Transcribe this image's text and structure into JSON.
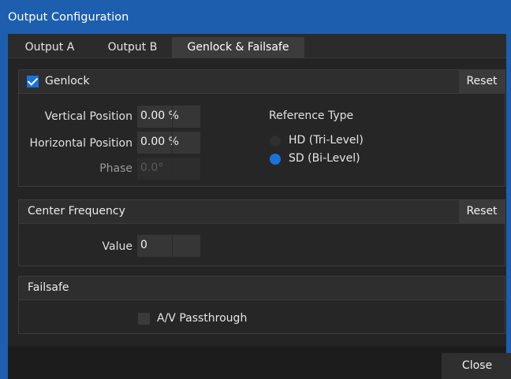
{
  "window": {
    "title": "Output Configuration"
  },
  "tabs": [
    {
      "label": "Output A"
    },
    {
      "label": "Output B"
    },
    {
      "label": "Genlock & Failsafe"
    }
  ],
  "genlock": {
    "label": "Genlock",
    "enabled": true,
    "reset_label": "Reset",
    "vertical_position": {
      "label": "Vertical Position",
      "value": "0.00 %"
    },
    "horizontal_position": {
      "label": "Horizontal Position",
      "value": "0.00 %"
    },
    "phase": {
      "label": "Phase",
      "value": "0.0°"
    },
    "reference_type": {
      "label": "Reference Type",
      "options": [
        {
          "label": "HD (Tri-Level)",
          "selected": false
        },
        {
          "label": "SD (Bi-Level)",
          "selected": true
        }
      ]
    }
  },
  "center_frequency": {
    "label": "Center Frequency",
    "reset_label": "Reset",
    "value_field": {
      "label": "Value",
      "value": "0"
    }
  },
  "failsafe": {
    "label": "Failsafe",
    "av_passthrough": {
      "label": "A/V Passthrough",
      "checked": false
    }
  },
  "footer": {
    "close_label": "Close"
  },
  "colors": {
    "titlebar": "#1d5fae",
    "accent": "#1a73d9"
  }
}
